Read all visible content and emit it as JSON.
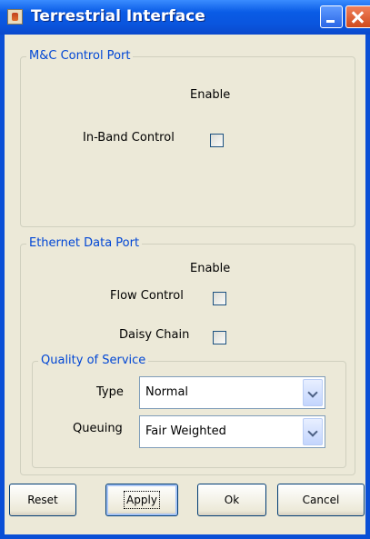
{
  "window": {
    "title": "Terrestrial Interface"
  },
  "mc_control_port": {
    "legend": "M&C Control Port",
    "enable_header": "Enable",
    "in_band_control": {
      "label": "In-Band Control",
      "checked": false
    }
  },
  "ethernet_data_port": {
    "legend": "Ethernet Data Port",
    "enable_header": "Enable",
    "flow_control": {
      "label": "Flow Control",
      "checked": false
    },
    "daisy_chain": {
      "label": "Daisy Chain",
      "checked": false
    },
    "qos": {
      "legend": "Quality of Service",
      "type": {
        "label": "Type",
        "value": "Normal"
      },
      "queuing": {
        "label": "Queuing",
        "value": "Fair Weighted"
      }
    }
  },
  "buttons": {
    "reset": "Reset",
    "apply": "Apply",
    "ok": "Ok",
    "cancel": "Cancel"
  },
  "colors": {
    "titlebar": "#0a55de",
    "legend_text": "#0046d5",
    "panel_bg": "#ece9d8"
  }
}
